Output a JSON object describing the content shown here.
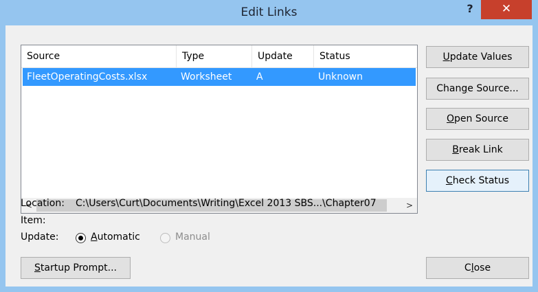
{
  "window": {
    "title": "Edit Links",
    "help_glyph": "?",
    "close_glyph": "✕"
  },
  "links_table": {
    "columns": [
      "Source",
      "Type",
      "Update",
      "Status"
    ],
    "rows": [
      {
        "source": "FleetOperatingCosts.xlsx",
        "type": "Worksheet",
        "update": "A",
        "status": "Unknown"
      }
    ],
    "scroll_left_glyph": "<",
    "scroll_right_glyph": ">"
  },
  "buttons": {
    "update_values": {
      "key": "U",
      "rest": "pdate Values"
    },
    "change_source": {
      "pre": "Chan",
      "key": "g",
      "rest": "e Source..."
    },
    "open_source": {
      "key": "O",
      "rest": "pen Source"
    },
    "break_link": {
      "key": "B",
      "rest": "reak Link"
    },
    "check_status": {
      "key": "C",
      "rest": "heck Status"
    },
    "startup_prompt": {
      "key": "S",
      "rest": "tartup Prompt..."
    },
    "close": {
      "pre": "C",
      "key": "l",
      "rest": "ose"
    }
  },
  "details": {
    "location_label": "Location:",
    "location_value": "C:\\Users\\Curt\\Documents\\Writing\\Excel 2013 SBS...\\Chapter07",
    "item_label": "Item:",
    "item_value": "",
    "update_label": "Update:",
    "automatic": {
      "key": "A",
      "rest": "utomatic",
      "selected": true
    },
    "manual": {
      "label": "Manual",
      "enabled": false
    }
  },
  "colors": {
    "selection": "#3399ff",
    "close_button": "#c7402c",
    "frame": "#95c5ef"
  }
}
